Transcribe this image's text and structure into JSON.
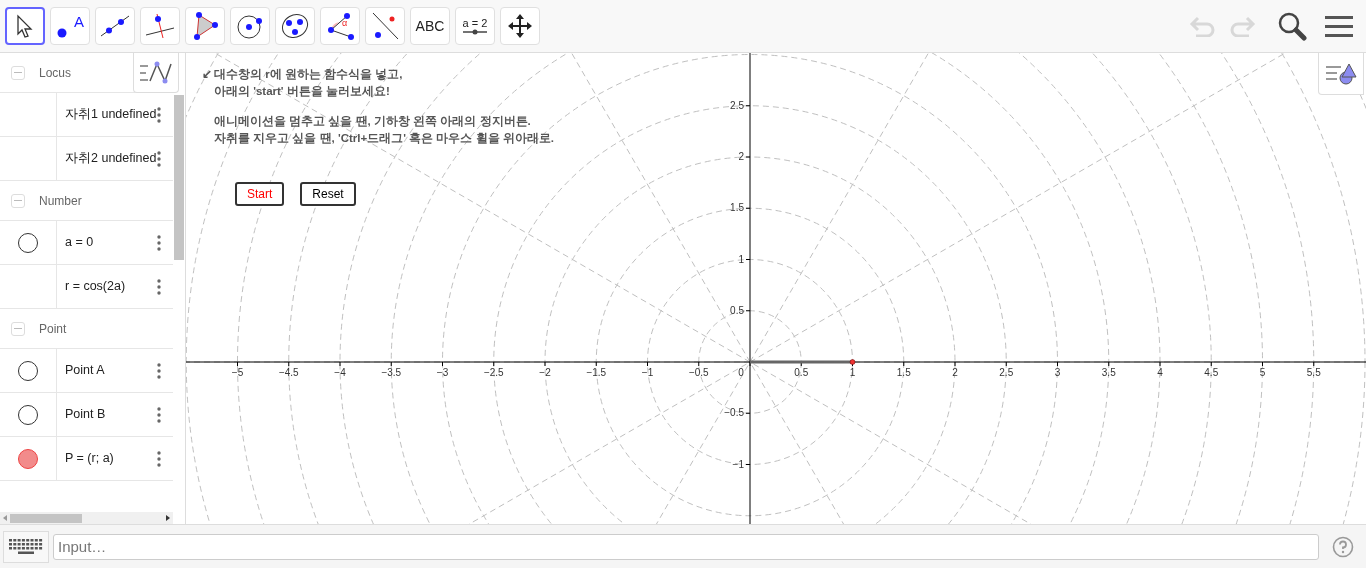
{
  "toolbar": {
    "tools": [
      {
        "kind": "move",
        "selected": true
      },
      {
        "kind": "point",
        "selected": false,
        "label": "A"
      },
      {
        "kind": "line",
        "selected": false
      },
      {
        "kind": "perpendicular",
        "selected": false
      },
      {
        "kind": "polygon",
        "selected": false
      },
      {
        "kind": "circle",
        "selected": false
      },
      {
        "kind": "conic",
        "selected": false
      },
      {
        "kind": "angle",
        "selected": false,
        "label": "α"
      },
      {
        "kind": "reflect",
        "selected": false
      },
      {
        "kind": "text",
        "selected": false,
        "label": "ABC"
      },
      {
        "kind": "slider",
        "selected": false,
        "label": "a = 2"
      },
      {
        "kind": "pan",
        "selected": false
      }
    ],
    "undo_disabled": true,
    "redo_disabled": true
  },
  "algebra": {
    "groups": [
      {
        "title": "Locus",
        "expanded": true,
        "items": [
          {
            "text": "자취1 undefined",
            "kind": "plain"
          },
          {
            "text": "자취2 undefined",
            "kind": "plain"
          }
        ]
      },
      {
        "title": "Number",
        "expanded": true,
        "items": [
          {
            "text": "a = 0",
            "kind": "toggle",
            "visible": false
          },
          {
            "text": "r = cos(2a)",
            "kind": "plain"
          }
        ]
      },
      {
        "title": "Point",
        "expanded": true,
        "items": [
          {
            "text": "Point A",
            "kind": "toggle",
            "visible": false
          },
          {
            "text": "Point B",
            "kind": "toggle",
            "visible": false
          },
          {
            "text": "P = (r; a)",
            "kind": "toggle",
            "visible": true,
            "color": "#f28b8b"
          }
        ]
      }
    ]
  },
  "graphics": {
    "instructions": [
      {
        "arrow": "↙",
        "parts": [
          "대수창의 r에 원하는 함수식을 넣고,",
          "아래의 **'start'** 버튼을 눌러보세요!"
        ]
      },
      {
        "parts": [
          "애니메이션을 멈추고 싶을 땐, 기하창 왼쪽 아래의 정지버튼.",
          "자취를 지우고 싶을 땐, 'Ctrl+드래그' 혹은 마우스 휠을 위아래로."
        ]
      }
    ],
    "buttons": [
      {
        "label": "Start",
        "color": "#ff0000"
      },
      {
        "label": "Reset",
        "color": "#000000"
      }
    ],
    "x_tick_labels": [
      "−5",
      "−4.5",
      "−4",
      "−3.5",
      "−3",
      "−2.5",
      "−2",
      "−1.5",
      "−1",
      "−0.5",
      "0",
      "0.5",
      "1",
      "1.5",
      "2",
      "2.5",
      "3",
      "3.5",
      "4",
      "4.5",
      "5",
      "5.5"
    ],
    "y_tick_labels": [
      "2.5",
      "2",
      "1.5",
      "1",
      "0.5",
      "−0.5",
      "−1"
    ]
  },
  "input_bar": {
    "placeholder": "Input…"
  }
}
